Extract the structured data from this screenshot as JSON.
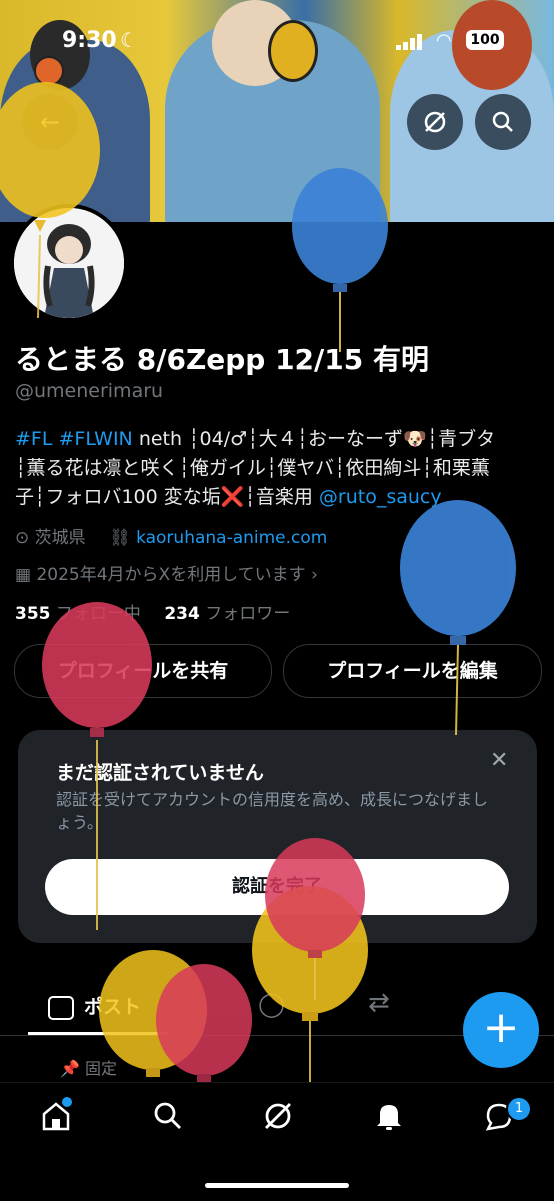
{
  "status_bar": {
    "time": "9:30",
    "battery": "100"
  },
  "profile": {
    "display_name": "るとまる 8/6Zepp 12/15 有明",
    "handle": "@umenerimaru",
    "bio": {
      "line1_tags": "#FL #FLWIN",
      "line1_text": " neth ┆04/♂┆大４┆おーなーず🐶┆青ブタ",
      "line2": "┆薫る花は凛と咲く┆俺ガイル┆僕ヤバ┆依田絢斗┆和栗薫",
      "line3_text": "子┆フォロバ100 変な垢❌┆音楽用 ",
      "line3_mention": "@ruto_saucy"
    },
    "location": "茨城県",
    "website": "kaoruhana-anime.com",
    "joined": "2025年4月からXを利用しています",
    "following_count": "355",
    "following_label": "フォロー中",
    "followers_count": "234",
    "followers_label": "フォロワー"
  },
  "buttons": {
    "share_profile": "プロフィールを共有",
    "edit_profile": "プロフィールを編集"
  },
  "verify_card": {
    "title": "まだ認証されていません",
    "description": "認証を受けてアカウントの信用度を高め、成長につなげましょう。",
    "cta": "認証を完了"
  },
  "tabs": {
    "posts": "ポスト"
  },
  "pinned_label": "固定",
  "nav": {
    "notification_badge": "1"
  },
  "colors": {
    "accent": "#1d9bf0",
    "balloon_yellow": "#f2c41d",
    "balloon_blue": "#3b82d6",
    "balloon_red": "#d83a5a"
  }
}
